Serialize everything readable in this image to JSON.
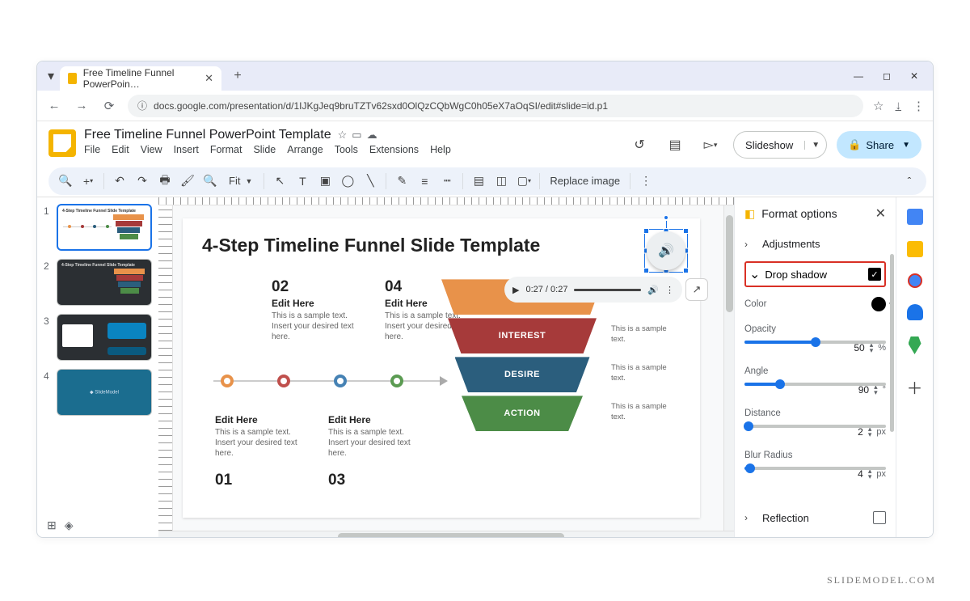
{
  "browser": {
    "tab_title": "Free Timeline Funnel PowerPoin…",
    "url": "docs.google.com/presentation/d/1IJKgJeq9bruTZTv62sxd0OlQzCQbWgC0h05eX7aOqSI/edit#slide=id.p1"
  },
  "app": {
    "doc_title": "Free Timeline Funnel PowerPoint Template",
    "menus": [
      "File",
      "Edit",
      "View",
      "Insert",
      "Format",
      "Slide",
      "Arrange",
      "Tools",
      "Extensions",
      "Help"
    ],
    "slideshow": "Slideshow",
    "share": "Share"
  },
  "toolbar": {
    "fit": "Fit",
    "replace_image": "Replace image"
  },
  "slide": {
    "title": "4-Step Timeline Funnel Slide Template",
    "numbers": [
      "02",
      "04",
      "01",
      "03"
    ],
    "edit_here": "Edit Here",
    "sample": "This is a sample text. Insert your desired text here.",
    "sample_short": "This is a sample text.",
    "funnel": [
      "",
      "INTEREST",
      "DESIRE",
      "ACTION"
    ],
    "audio_time": "0:27 / 0:27"
  },
  "panel": {
    "title": "Format options",
    "adjustments": "Adjustments",
    "drop_shadow": "Drop shadow",
    "color": "Color",
    "opacity": {
      "label": "Opacity",
      "value": "50",
      "unit": "%",
      "pct": 50
    },
    "angle": {
      "label": "Angle",
      "value": "90",
      "unit": "°",
      "pct": 25
    },
    "distance": {
      "label": "Distance",
      "value": "2",
      "unit": "px",
      "pct": 3
    },
    "blur": {
      "label": "Blur Radius",
      "value": "4",
      "unit": "px",
      "pct": 4
    },
    "reflection": "Reflection"
  },
  "watermark": "SLIDEMODEL.COM"
}
